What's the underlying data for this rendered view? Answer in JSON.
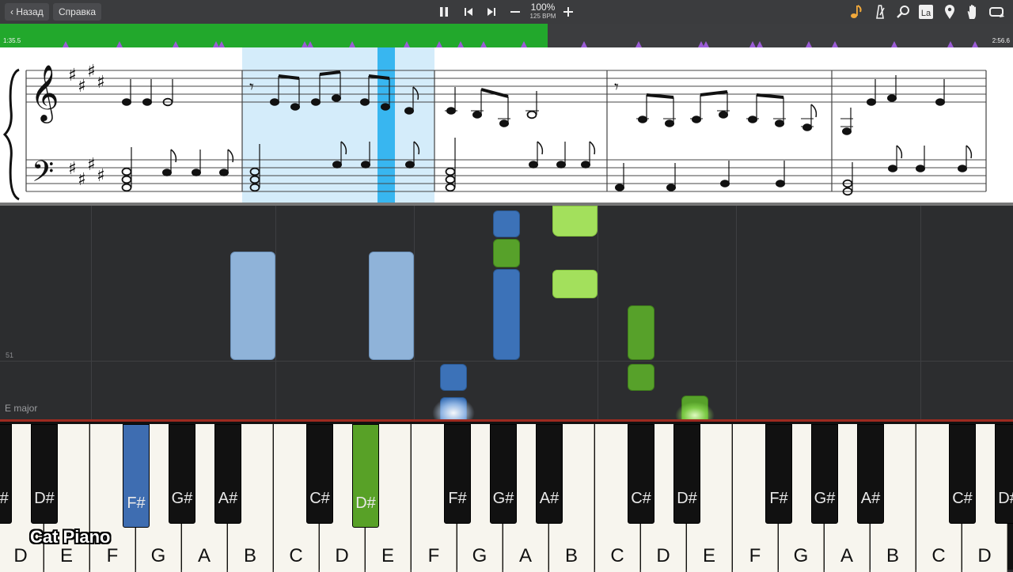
{
  "toolbar": {
    "back_label": "Назад",
    "help_label": "Справка",
    "zoom_percent": "100%",
    "tempo": "125 BPM",
    "icons": [
      "pause-icon",
      "previous-icon",
      "next-icon",
      "minus-icon",
      "plus-icon",
      "note-icon",
      "metronome-icon",
      "magnifier-icon",
      "la-icon",
      "pin-icon",
      "hand-icon",
      "loop-icon"
    ],
    "la_label": "La"
  },
  "timeline": {
    "current_time": "1:35.5",
    "total_time": "2:56.6",
    "progress_fraction": 0.541
  },
  "score": {
    "key": "E major"
  },
  "roll": {
    "measure_number": "51",
    "key_label": "E major"
  },
  "keyboard": {
    "white_keys": [
      "D",
      "E",
      "F",
      "G",
      "A",
      "B",
      "C",
      "D",
      "E",
      "F",
      "G",
      "A",
      "B",
      "C",
      "D",
      "E",
      "F",
      "G",
      "A",
      "B",
      "C",
      "D"
    ],
    "black_keys": [
      "C#",
      "D#",
      "F#",
      "G#",
      "A#",
      "C#",
      "D#",
      "F#",
      "G#",
      "A#",
      "C#",
      "D#",
      "F#",
      "G#",
      "A#",
      "C#",
      "D#"
    ],
    "pressed": {
      "F#": "#3e6db1",
      "D#": "#58a127"
    }
  },
  "branding": {
    "logo_text": "Cat Piano"
  },
  "colors": {
    "timeline_played": "#22a82c",
    "marker": "#9b5cd6",
    "right_hand": "#3c72b8",
    "left_hand": "#57a12a",
    "highlight": "#d4ecfa",
    "cursor": "#38b6f0"
  }
}
